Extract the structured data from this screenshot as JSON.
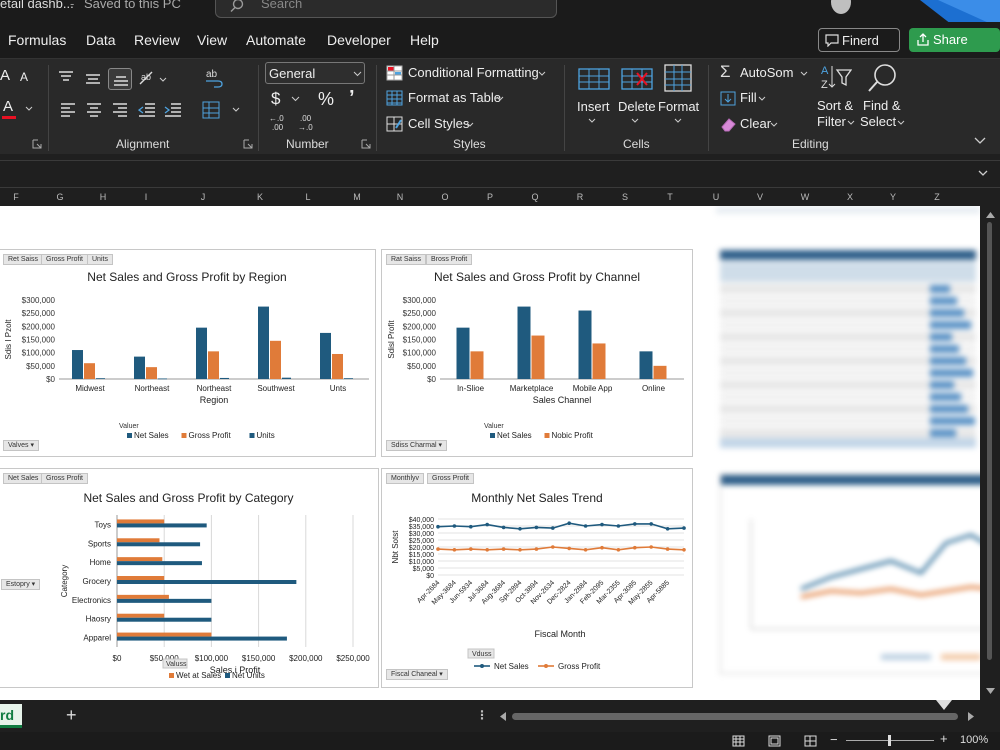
{
  "titlebar": {
    "doc_name": "etail dashb...",
    "save_status": "Saved to this PC",
    "search_placeholder": "Search"
  },
  "menu": {
    "items": [
      "Formulas",
      "Data",
      "Review",
      "View",
      "Automate",
      "Developer",
      "Help"
    ],
    "comments_label": "Finerd",
    "share_label": "Share"
  },
  "ribbon": {
    "font_a_large": "A",
    "font_a_small": "A",
    "font_color_a": "A",
    "number_format": "General",
    "currency": "$",
    "percent": "%",
    "comma": "’",
    "conditional_formatting": "Conditional Formatting",
    "format_as_table": "Format as Table",
    "cell_styles": "Cell Styles",
    "insert": "Insert",
    "delete": "Delete",
    "format": "Format",
    "autosum": "AutoSom",
    "fill": "Fill",
    "clear": "Clear",
    "sort_filter_1": "Sort &",
    "sort_filter_2": "Filter",
    "find_select_1": "Find &",
    "find_select_2": "Select",
    "groups": {
      "alignment": "Alignment",
      "number": "Number",
      "styles": "Styles",
      "cells": "Cells",
      "editing": "Editing"
    }
  },
  "columns": [
    "F",
    "G",
    "H",
    "I",
    "J",
    "K",
    "L",
    "M",
    "N",
    "O",
    "P",
    "Q",
    "R",
    "S",
    "T",
    "U",
    "V",
    "W",
    "X",
    "Y",
    "Z"
  ],
  "colors": {
    "navy": "#1f5a7e",
    "orange": "#e07b39",
    "excel_green": "#107c41"
  },
  "charts": {
    "region": {
      "tags": [
        "Ret Saiss",
        "Gross Profit",
        "Units"
      ],
      "values_dropdown": "Valves",
      "legend_title": "Valuer"
    },
    "channel": {
      "tags": [
        "Rat Saiss",
        "Bross Profit"
      ],
      "dropdown": "Sdiss Charmal",
      "legend_title": "Valuer"
    },
    "category": {
      "tags": [
        "Net Sales",
        "Gross Profit"
      ],
      "dropdown": "Estopry",
      "legend_title": "Valuss"
    },
    "trend": {
      "tags": [
        "Monthlyv",
        "Gross Profit"
      ],
      "dropdown": "Fiscal Chaneal",
      "legend_title": "Vduss"
    }
  },
  "chart_data": [
    {
      "type": "bar",
      "title": "Net Sales and Gross Profit by Region",
      "xlabel": "Region",
      "ylabel": "Sdis I Pzolt",
      "categories": [
        "Midwest",
        "Northeast",
        "Northeast",
        "Southwest",
        "Unts"
      ],
      "yticks": [
        "$300,000",
        "$250,000",
        "$200,000",
        "$150,000",
        "$100,000",
        "$50,000",
        "$0"
      ],
      "ylim": [
        0,
        300000
      ],
      "series": [
        {
          "name": "Net Sales",
          "values": [
            110000,
            85000,
            195000,
            275000,
            175000
          ],
          "color": "#1f5a7e"
        },
        {
          "name": "Gross Profit",
          "values": [
            60000,
            45000,
            105000,
            145000,
            95000
          ],
          "color": "#e07b39"
        },
        {
          "name": "Units",
          "values": [
            3000,
            2000,
            4000,
            5000,
            3000
          ],
          "color": "#1f5a7e"
        }
      ]
    },
    {
      "type": "bar",
      "title": "Net Sales and Gross Profit by Channel",
      "xlabel": "Sales Channel",
      "ylabel": "Sdisl Profit",
      "categories": [
        "In-Slioe",
        "Marketplace",
        "Mobile App",
        "Online"
      ],
      "yticks": [
        "$300,000",
        "$250,000",
        "$200,000",
        "$150,000",
        "$100,000",
        "$50,000",
        "$0"
      ],
      "ylim": [
        0,
        300000
      ],
      "series": [
        {
          "name": "Net Sales",
          "values": [
            195000,
            275000,
            260000,
            105000
          ],
          "color": "#1f5a7e"
        },
        {
          "name": "Nobic Profit",
          "values": [
            105000,
            165000,
            135000,
            50000
          ],
          "color": "#e07b39"
        }
      ]
    },
    {
      "type": "bar",
      "orientation": "horizontal",
      "title": "Net Sales and Gross Profit by Category",
      "xlabel": "Sales i Profit",
      "ylabel": "Category",
      "categories": [
        "Toys",
        "Sports",
        "Home",
        "Grocery",
        "Electronics",
        "Haosry",
        "Apparel"
      ],
      "xticks": [
        "$0",
        "$50,000",
        "$100,000",
        "$150,000",
        "$200,000",
        "$250,000"
      ],
      "xlim": [
        0,
        250000
      ],
      "series": [
        {
          "name": "Wet at Sales",
          "values": [
            50000,
            45000,
            48000,
            50000,
            55000,
            50000,
            100000
          ],
          "color": "#e07b39"
        },
        {
          "name": "Net Units",
          "values": [
            95000,
            88000,
            90000,
            190000,
            100000,
            100000,
            180000
          ],
          "color": "#1f5a7e"
        }
      ]
    },
    {
      "type": "line",
      "title": "Monthly Net Sales Trend",
      "xlabel": "Fiscal Month",
      "ylabel": "Nbt Sotst",
      "categories": [
        "Apr-2684",
        "May-3684",
        "Jun-5934",
        "Jul-3684",
        "Aug-3684",
        "Spt-2894",
        "Oct-3894",
        "Nov-2634",
        "Dec-2824",
        "Jan-2884",
        "Feb-2095",
        "Mar-2355",
        "Apr-3085",
        "May-2855",
        "Apr-5885",
        "Jun-2585"
      ],
      "yticks": [
        "$40,000",
        "$35,000",
        "$30,000",
        "$25,000",
        "$20,000",
        "$15,000",
        "$10,000",
        "$5,000",
        "$0"
      ],
      "ylim": [
        0,
        40000
      ],
      "series": [
        {
          "name": "Net Sales",
          "values": [
            34500,
            35000,
            34500,
            36000,
            34000,
            33000,
            34000,
            33500,
            37000,
            35000,
            36000,
            35000,
            36500,
            36500,
            33000,
            33500
          ],
          "color": "#1f5a7e"
        },
        {
          "name": "Gross Profit",
          "values": [
            18500,
            18000,
            18500,
            18000,
            18500,
            18000,
            18500,
            20000,
            19000,
            18000,
            19500,
            18000,
            19500,
            20000,
            18500,
            18000
          ],
          "color": "#e07b39"
        }
      ]
    }
  ],
  "sheet_tabs": {
    "active": "rd",
    "add": "+"
  },
  "status": {
    "zoom": "100%"
  }
}
